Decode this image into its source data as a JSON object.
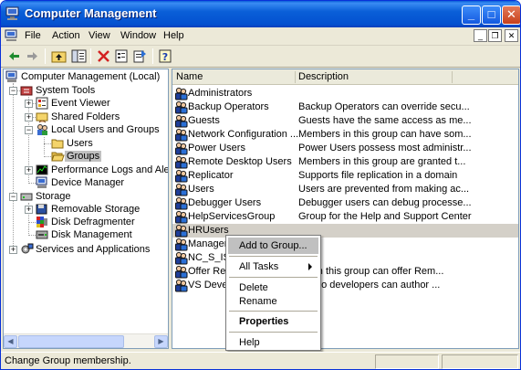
{
  "window": {
    "title": "Computer Management"
  },
  "menu": {
    "items": [
      "File",
      "Action",
      "View",
      "Window",
      "Help"
    ]
  },
  "toolbar": {
    "buttons": [
      "back-arrow-icon",
      "forward-arrow-icon",
      "up-folder-icon",
      "show-hide-tree-icon",
      "delete-icon",
      "properties-icon",
      "export-list-icon",
      "help-icon"
    ]
  },
  "tree": {
    "items": [
      {
        "label": "Computer Management (Local)",
        "icon": "computer-management-icon"
      },
      {
        "label": "System Tools",
        "icon": "system-tools-icon",
        "expander": "−"
      },
      {
        "label": "Event Viewer",
        "icon": "event-viewer-icon",
        "expander": "+"
      },
      {
        "label": "Shared Folders",
        "icon": "shared-folders-icon",
        "expander": "+"
      },
      {
        "label": "Local Users and Groups",
        "icon": "users-groups-icon",
        "expander": "−"
      },
      {
        "label": "Users",
        "icon": "folder-icon"
      },
      {
        "label": "Groups",
        "icon": "open-folder-icon",
        "selected": true
      },
      {
        "label": "Performance Logs and Alerts",
        "icon": "performance-icon",
        "expander": "+"
      },
      {
        "label": "Device Manager",
        "icon": "device-manager-icon"
      },
      {
        "label": "Storage",
        "icon": "storage-icon",
        "expander": "−"
      },
      {
        "label": "Removable Storage",
        "icon": "removable-storage-icon",
        "expander": "+"
      },
      {
        "label": "Disk Defragmenter",
        "icon": "defrag-icon"
      },
      {
        "label": "Disk Management",
        "icon": "disk-management-icon"
      },
      {
        "label": "Services and Applications",
        "icon": "services-icon",
        "expander": "+"
      }
    ]
  },
  "list": {
    "columns": [
      "Name",
      "Description"
    ],
    "rows": [
      {
        "name": "Administrators",
        "description": ""
      },
      {
        "name": "Backup Operators",
        "description": "Backup Operators can override secu..."
      },
      {
        "name": "Guests",
        "description": "Guests have the same access as me..."
      },
      {
        "name": "Network Configuration ...",
        "description": "Members in this group can have som..."
      },
      {
        "name": "Power Users",
        "description": "Power Users possess most administr..."
      },
      {
        "name": "Remote Desktop Users",
        "description": "Members in this group are granted t..."
      },
      {
        "name": "Replicator",
        "description": "Supports file replication in a domain"
      },
      {
        "name": "Users",
        "description": "Users are prevented from making ac..."
      },
      {
        "name": "Debugger Users",
        "description": "Debugger users can debug processe..."
      },
      {
        "name": "HelpServicesGroup",
        "description": "Group for the Help and Support Center"
      },
      {
        "name": "HRUsers",
        "description": "",
        "highlighted": true
      },
      {
        "name": "Manager",
        "description": ""
      },
      {
        "name": "NC_S_IS",
        "description": ""
      },
      {
        "name": "Offer Re",
        "description": "ers in this group can offer Rem..."
      },
      {
        "name": "VS Devel",
        "description": "Studio developers can author ..."
      }
    ]
  },
  "context_menu": {
    "items": [
      {
        "label": "Add to Group...",
        "hover": true
      },
      {
        "label": "All Tasks",
        "submenu": true
      },
      {
        "label": "Delete"
      },
      {
        "label": "Rename"
      },
      {
        "label": "Properties",
        "bold": true
      },
      {
        "label": "Help"
      }
    ]
  },
  "status": {
    "text": "Change Group membership."
  },
  "colors": {
    "titlebar": "#0a5fd8",
    "selection": "#c0c0c0",
    "face": "#ece9d8"
  }
}
